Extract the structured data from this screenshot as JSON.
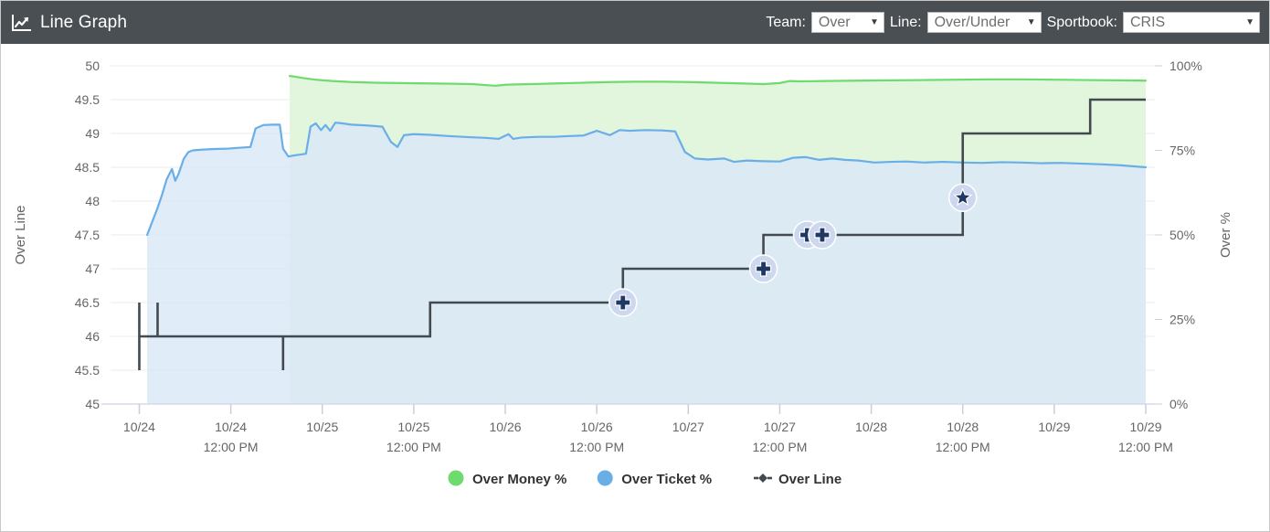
{
  "header": {
    "title": "Line Graph",
    "icon": "line-chart-icon",
    "controls": [
      {
        "label": "Team:",
        "value": "Over",
        "name": "team"
      },
      {
        "label": "Line:",
        "value": "Over/Under",
        "name": "line"
      },
      {
        "label": "Sportbook:",
        "value": "CRIS",
        "name": "sportbook"
      }
    ]
  },
  "colors": {
    "header_bg": "#4a4f54",
    "money_line": "#6ddb6d",
    "money_fill": "#e2f6dd",
    "ticket_line": "#6aaee8",
    "ticket_fill": "#dbe9f7",
    "over_line": "#434a4f",
    "marker_badge": "#cdd8ef",
    "marker_glyph": "#1f3864",
    "grid": "#ebebeb",
    "axis_text": "#666666"
  },
  "chart_data": {
    "type": "line",
    "title": "Line Graph",
    "xlabel": "",
    "ylabel": "Over Line",
    "y2label": "Over %",
    "ylim": [
      45,
      50
    ],
    "y2lim": [
      0,
      100
    ],
    "ygrid": true,
    "legend_position": "bottom",
    "y_ticks": [
      "45",
      "45.5",
      "46",
      "46.5",
      "47",
      "47.5",
      "48",
      "48.5",
      "49",
      "49.5",
      "50"
    ],
    "y2_ticks": [
      "0%",
      "25%",
      "50%",
      "75%",
      "100%"
    ],
    "x_ticks": [
      {
        "date": "10/24",
        "time": ""
      },
      {
        "date": "10/24",
        "time": "12:00 PM"
      },
      {
        "date": "10/25",
        "time": ""
      },
      {
        "date": "10/25",
        "time": "12:00 PM"
      },
      {
        "date": "10/26",
        "time": ""
      },
      {
        "date": "10/26",
        "time": "12:00 PM"
      },
      {
        "date": "10/27",
        "time": ""
      },
      {
        "date": "10/27",
        "time": "12:00 PM"
      },
      {
        "date": "10/28",
        "time": ""
      },
      {
        "date": "10/28",
        "time": "12:00 PM"
      },
      {
        "date": "10/29",
        "time": ""
      },
      {
        "date": "10/29",
        "time": "12:00 PM"
      }
    ],
    "legend": [
      {
        "label": "Over Money %",
        "marker": "circle",
        "color": "#6ddb6d"
      },
      {
        "label": "Over Ticket %",
        "marker": "circle",
        "color": "#6aaee8"
      },
      {
        "label": "Over Line",
        "marker": "dash-diamond",
        "color": "#434a4f"
      }
    ],
    "series": [
      {
        "name": "Over Money %",
        "axis": "right",
        "unit": "%",
        "points": [
          [
            2.3,
            97.0
          ],
          [
            2.38,
            96.8
          ],
          [
            2.5,
            96.4
          ],
          [
            2.7,
            95.9
          ],
          [
            2.95,
            95.5
          ],
          [
            3.25,
            95.2
          ],
          [
            3.6,
            95.0
          ],
          [
            4.0,
            94.9
          ],
          [
            4.4,
            94.8
          ],
          [
            4.8,
            94.7
          ],
          [
            5.1,
            94.6
          ],
          [
            5.3,
            94.3
          ],
          [
            5.45,
            94.1
          ],
          [
            5.6,
            94.4
          ],
          [
            5.75,
            94.5
          ],
          [
            6.0,
            94.6
          ],
          [
            6.4,
            94.8
          ],
          [
            6.8,
            95.0
          ],
          [
            7.2,
            95.2
          ],
          [
            7.6,
            95.3
          ],
          [
            8.0,
            95.3
          ],
          [
            8.4,
            95.2
          ],
          [
            8.8,
            95.0
          ],
          [
            9.2,
            94.8
          ],
          [
            9.55,
            94.6
          ],
          [
            9.8,
            94.9
          ],
          [
            9.95,
            95.5
          ],
          [
            10.1,
            95.4
          ],
          [
            10.5,
            95.5
          ],
          [
            11.0,
            95.6
          ],
          [
            11.5,
            95.7
          ],
          [
            12.0,
            95.8
          ],
          [
            12.5,
            95.9
          ],
          [
            13.0,
            96.0
          ],
          [
            13.5,
            96.0
          ],
          [
            14.0,
            95.9
          ],
          [
            14.5,
            95.8
          ],
          [
            15.0,
            95.7
          ],
          [
            15.4,
            95.6
          ]
        ]
      },
      {
        "name": "Over Ticket %",
        "axis": "right",
        "unit": "%",
        "points": [
          [
            0.12,
            50.0
          ],
          [
            0.2,
            54.0
          ],
          [
            0.28,
            58.0
          ],
          [
            0.35,
            62.0
          ],
          [
            0.42,
            66.5
          ],
          [
            0.5,
            69.5
          ],
          [
            0.55,
            66.0
          ],
          [
            0.6,
            68.0
          ],
          [
            0.68,
            72.5
          ],
          [
            0.75,
            74.5
          ],
          [
            0.82,
            75.0
          ],
          [
            0.95,
            75.2
          ],
          [
            1.15,
            75.4
          ],
          [
            1.35,
            75.5
          ],
          [
            1.55,
            75.8
          ],
          [
            1.7,
            76.0
          ],
          [
            1.78,
            81.5
          ],
          [
            1.9,
            82.5
          ],
          [
            2.05,
            82.6
          ],
          [
            2.15,
            82.6
          ],
          [
            2.2,
            75.5
          ],
          [
            2.28,
            73.2
          ],
          [
            2.4,
            73.6
          ],
          [
            2.48,
            73.8
          ],
          [
            2.55,
            74.0
          ],
          [
            2.62,
            82.0
          ],
          [
            2.7,
            83.0
          ],
          [
            2.78,
            81.0
          ],
          [
            2.85,
            82.5
          ],
          [
            2.92,
            80.8
          ],
          [
            3.0,
            83.2
          ],
          [
            3.1,
            83.0
          ],
          [
            3.25,
            82.6
          ],
          [
            3.45,
            82.4
          ],
          [
            3.6,
            82.2
          ],
          [
            3.72,
            82.0
          ],
          [
            3.85,
            77.5
          ],
          [
            3.95,
            76.0
          ],
          [
            4.05,
            79.5
          ],
          [
            4.2,
            79.8
          ],
          [
            4.45,
            79.6
          ],
          [
            4.75,
            79.2
          ],
          [
            5.05,
            78.9
          ],
          [
            5.3,
            78.7
          ],
          [
            5.5,
            78.4
          ],
          [
            5.65,
            79.8
          ],
          [
            5.72,
            78.4
          ],
          [
            5.85,
            78.8
          ],
          [
            6.1,
            79.0
          ],
          [
            6.35,
            79.0
          ],
          [
            6.55,
            79.2
          ],
          [
            6.8,
            79.4
          ],
          [
            7.0,
            80.8
          ],
          [
            7.2,
            79.5
          ],
          [
            7.35,
            81.0
          ],
          [
            7.5,
            80.8
          ],
          [
            7.75,
            81.0
          ],
          [
            8.0,
            80.9
          ],
          [
            8.2,
            80.6
          ],
          [
            8.35,
            74.5
          ],
          [
            8.5,
            72.6
          ],
          [
            8.7,
            72.3
          ],
          [
            8.95,
            72.6
          ],
          [
            9.1,
            71.6
          ],
          [
            9.3,
            72.0
          ],
          [
            9.55,
            71.8
          ],
          [
            9.8,
            71.7
          ],
          [
            10.0,
            72.8
          ],
          [
            10.2,
            73.0
          ],
          [
            10.4,
            72.2
          ],
          [
            10.6,
            72.6
          ],
          [
            10.8,
            72.2
          ],
          [
            11.0,
            72.0
          ],
          [
            11.25,
            71.4
          ],
          [
            11.5,
            71.6
          ],
          [
            11.75,
            71.7
          ],
          [
            12.0,
            71.4
          ],
          [
            12.3,
            71.6
          ],
          [
            12.6,
            71.4
          ],
          [
            12.9,
            71.3
          ],
          [
            13.2,
            71.5
          ],
          [
            13.5,
            71.4
          ],
          [
            13.8,
            71.2
          ],
          [
            14.1,
            71.3
          ],
          [
            14.4,
            71.1
          ],
          [
            14.7,
            70.9
          ],
          [
            15.0,
            70.6
          ],
          [
            15.2,
            70.3
          ],
          [
            15.4,
            70.0
          ]
        ]
      },
      {
        "name": "Over Line",
        "axis": "left",
        "type": "step",
        "points": [
          [
            0.0,
            46.5
          ],
          [
            0.0,
            45.5
          ],
          [
            0.0,
            46.0
          ],
          [
            0.28,
            46.0
          ],
          [
            0.28,
            46.5
          ],
          [
            0.28,
            46.0
          ],
          [
            2.2,
            46.0
          ],
          [
            2.2,
            45.5
          ],
          [
            2.2,
            46.0
          ],
          [
            4.45,
            46.0
          ],
          [
            4.45,
            46.5
          ],
          [
            7.4,
            46.5
          ],
          [
            7.4,
            47.0
          ],
          [
            9.55,
            47.0
          ],
          [
            9.55,
            47.5
          ],
          [
            10.35,
            47.5
          ],
          [
            12.6,
            47.5
          ],
          [
            12.6,
            48.0
          ],
          [
            12.6,
            49.0
          ],
          [
            14.55,
            49.0
          ],
          [
            14.55,
            49.5
          ],
          [
            15.4,
            49.5
          ]
        ],
        "markers": [
          {
            "x": 7.4,
            "y": 46.5,
            "glyph": "plus"
          },
          {
            "x": 9.55,
            "y": 47.0,
            "glyph": "plus"
          },
          {
            "x": 10.22,
            "y": 47.5,
            "glyph": "plus"
          },
          {
            "x": 10.45,
            "y": 47.5,
            "glyph": "plus"
          },
          {
            "x": 12.6,
            "y": 48.05,
            "glyph": "star"
          }
        ]
      }
    ]
  }
}
